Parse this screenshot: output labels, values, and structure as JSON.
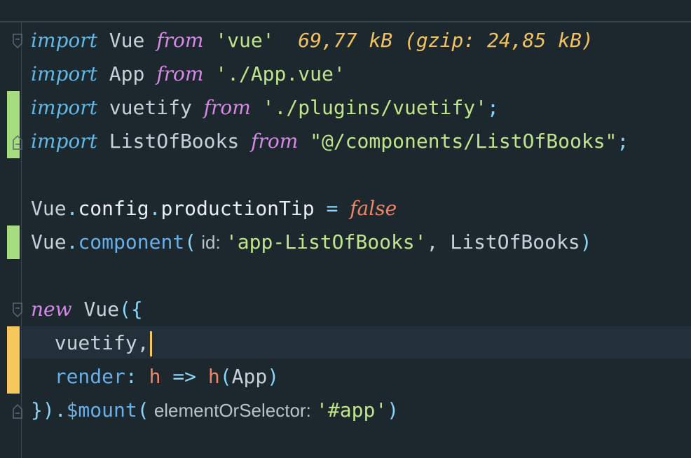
{
  "colors": {
    "background": "#1d282e",
    "keyword": "#5fb8e6",
    "from_keyword": "#d787e8",
    "string": "#bfe58a",
    "size_hint": "#f2c25e",
    "boolean": "#f08467",
    "gutter_added": "#a6de7f",
    "gutter_modified": "#f7c75c"
  },
  "icons": {
    "fold_open": "fold-open-icon",
    "fold_close": "fold-close-icon"
  },
  "code": {
    "line1": {
      "kw": "import",
      "id": " Vue ",
      "from": "from",
      "str": " 'vue'",
      "size_hint": "  69,77 kB (gzip: 24,85 kB)"
    },
    "line2": {
      "kw": "import",
      "id": " App ",
      "from": "from",
      "str": " './App.vue'"
    },
    "line3": {
      "kw": "import",
      "id": " vuetify ",
      "from": "from",
      "str": " './plugins/vuetify'",
      "end": ";"
    },
    "line4": {
      "kw": "import",
      "id": " ListOfBooks ",
      "from": "from",
      "str": " \"@/components/ListOfBooks\"",
      "end": ";"
    },
    "line6": {
      "obj": "Vue",
      "dot1": ".",
      "prop1": "config",
      "dot2": ".",
      "prop2": "productionTip",
      "op": " = ",
      "bool": "false"
    },
    "line7": {
      "obj": "Vue",
      "dot": ".",
      "method": "component",
      "paren": "(",
      "inlay": " id: ",
      "str": "'app-ListOfBooks'",
      "comma": ", ",
      "arg": "ListOfBooks",
      "close": ")"
    },
    "line9": {
      "kw": "new",
      "space": " ",
      "cls": "Vue",
      "open": "({"
    },
    "line10": {
      "text": "  vuetify",
      "comma": ","
    },
    "line11": {
      "indent": "  ",
      "key": "render",
      "colon": ": ",
      "p": "h",
      "arrow": " => ",
      "call": "h",
      "open": "(",
      "arg": "App",
      "close": ")"
    },
    "line12": {
      "close": "})",
      "dot": ".",
      "method": "$mount",
      "open": "(",
      "inlay": " elementOrSelector: ",
      "str": "'#app'",
      "close2": ")"
    }
  }
}
